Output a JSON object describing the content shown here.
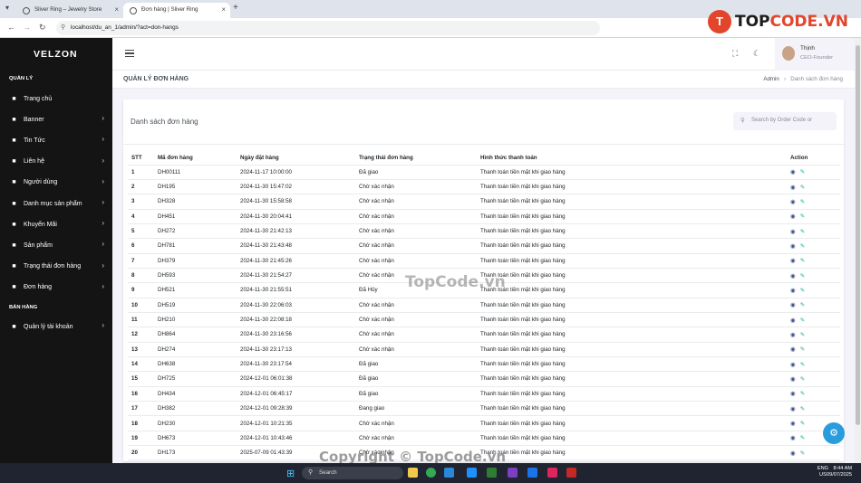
{
  "browser": {
    "tabs": [
      {
        "title": "Sliver Ring – Jewelry Store"
      },
      {
        "title": "Đơn hàng | Sliver Ring"
      }
    ],
    "url": "localhost/du_an_1/admin/?act=don-hangs"
  },
  "watermark_logo": {
    "prefix": "T",
    "text_a": "TOP",
    "text_b": "CODE.VN"
  },
  "sidebar": {
    "brand": "VELZON",
    "section_main": "QUẢN LÝ",
    "items": [
      {
        "label": "Trang chủ",
        "icon": "dashboard-icon",
        "chevron": false
      },
      {
        "label": "Banner",
        "icon": "image-icon",
        "chevron": true
      },
      {
        "label": "Tin Tức",
        "icon": "news-icon",
        "chevron": true
      },
      {
        "label": "Liên hệ",
        "icon": "contacts-icon",
        "chevron": true
      },
      {
        "label": "Người dùng",
        "icon": "user-icon",
        "chevron": true
      },
      {
        "label": "Danh mục sản phẩm",
        "icon": "category-icon",
        "chevron": true
      },
      {
        "label": "Khuyến Mãi",
        "icon": "tag-icon",
        "chevron": true
      },
      {
        "label": "Sản phẩm",
        "icon": "box-icon",
        "chevron": true
      },
      {
        "label": "Trạng thái đơn hàng",
        "icon": "cart-icon",
        "chevron": true
      },
      {
        "label": "Đơn hàng",
        "icon": "bag-icon",
        "chevron": true
      }
    ],
    "section_sales": "BÁN HÀNG",
    "sales_items": [
      {
        "label": "Quản lý tài khoản",
        "icon": "account-icon",
        "chevron": true
      }
    ]
  },
  "topbar": {
    "user_name": "Thịnh",
    "user_role": "CEO-Founder"
  },
  "page": {
    "title": "QUẢN LÝ ĐƠN HÀNG",
    "breadcrumb_root": "Admin",
    "breadcrumb_current": "Danh sách đơn hàng"
  },
  "card": {
    "title": "Danh sách đơn hàng",
    "search_placeholder": "Search by Order Code or"
  },
  "table": {
    "headers": [
      "STT",
      "Mã đơn hàng",
      "Ngày đặt hàng",
      "Trạng thái đơn hàng",
      "Hình thức thanh toán",
      "Action"
    ],
    "rows": [
      [
        "1",
        "DH00111",
        "2024-11-17 10:00:00",
        "Đã giao",
        "Thanh toán tiền mặt khi giao hàng"
      ],
      [
        "2",
        "DH195",
        "2024-11-30 15:47:02",
        "Chờ xác nhận",
        "Thanh toán tiền mặt khi giao hàng"
      ],
      [
        "3",
        "DH328",
        "2024-11-30 15:58:58",
        "Chờ xác nhận",
        "Thanh toán tiền mặt khi giao hàng"
      ],
      [
        "4",
        "DH451",
        "2024-11-30 20:04:41",
        "Chờ xác nhận",
        "Thanh toán tiền mặt khi giao hàng"
      ],
      [
        "5",
        "DH272",
        "2024-11-30 21:42:13",
        "Chờ xác nhận",
        "Thanh toán tiền mặt khi giao hàng"
      ],
      [
        "6",
        "DH781",
        "2024-11-30 21:43:48",
        "Chờ xác nhận",
        "Thanh toán tiền mặt khi giao hàng"
      ],
      [
        "7",
        "DH379",
        "2024-11-30 21:45:26",
        "Chờ xác nhận",
        "Thanh toán tiền mặt khi giao hàng"
      ],
      [
        "8",
        "DH593",
        "2024-11-30 21:54:27",
        "Chờ xác nhận",
        "Thanh toán tiền mặt khi giao hàng"
      ],
      [
        "9",
        "DH521",
        "2024-11-30 21:55:51",
        "Đã Hủy",
        "Thanh toán tiền mặt khi giao hàng"
      ],
      [
        "10",
        "DH519",
        "2024-11-30 22:06:03",
        "Chờ xác nhận",
        "Thanh toán tiền mặt khi giao hàng"
      ],
      [
        "11",
        "DH210",
        "2024-11-30 22:08:18",
        "Chờ xác nhận",
        "Thanh toán tiền mặt khi giao hàng"
      ],
      [
        "12",
        "DH864",
        "2024-11-30 23:16:56",
        "Chờ xác nhận",
        "Thanh toán tiền mặt khi giao hàng"
      ],
      [
        "13",
        "DH274",
        "2024-11-30 23:17:13",
        "Chờ xác nhận",
        "Thanh toán tiền mặt khi giao hàng"
      ],
      [
        "14",
        "DH638",
        "2024-11-30 23:17:54",
        "Đã giao",
        "Thanh toán tiền mặt khi giao hàng"
      ],
      [
        "15",
        "DH725",
        "2024-12-01 06:01:38",
        "Đã giao",
        "Thanh toán tiền mặt khi giao hàng"
      ],
      [
        "16",
        "DH434",
        "2024-12-01 06:45:17",
        "Đã giao",
        "Thanh toán tiền mặt khi giao hàng"
      ],
      [
        "17",
        "DH382",
        "2024-12-01 09:28:39",
        "Đang giao",
        "Thanh toán tiền mặt khi giao hàng"
      ],
      [
        "18",
        "DH230",
        "2024-12-01 10:21:35",
        "Chờ xác nhận",
        "Thanh toán tiền mặt khi giao hàng"
      ],
      [
        "19",
        "DH673",
        "2024-12-01 10:43:46",
        "Chờ xác nhận",
        "Thanh toán tiền mặt khi giao hàng"
      ],
      [
        "20",
        "DH173",
        "2025-07-09 01:43:39",
        "Chờ xác nhận",
        "Thanh toán tiền mặt khi giao hàng"
      ]
    ]
  },
  "overlay": {
    "center_watermark": "TopCode.vn",
    "bottom_watermark": "Copyright © TopCode.vn"
  },
  "taskbar": {
    "search": "Search",
    "lang": "ENG",
    "region": "US",
    "time": "8:44 AM",
    "date": "09/07/2025"
  }
}
